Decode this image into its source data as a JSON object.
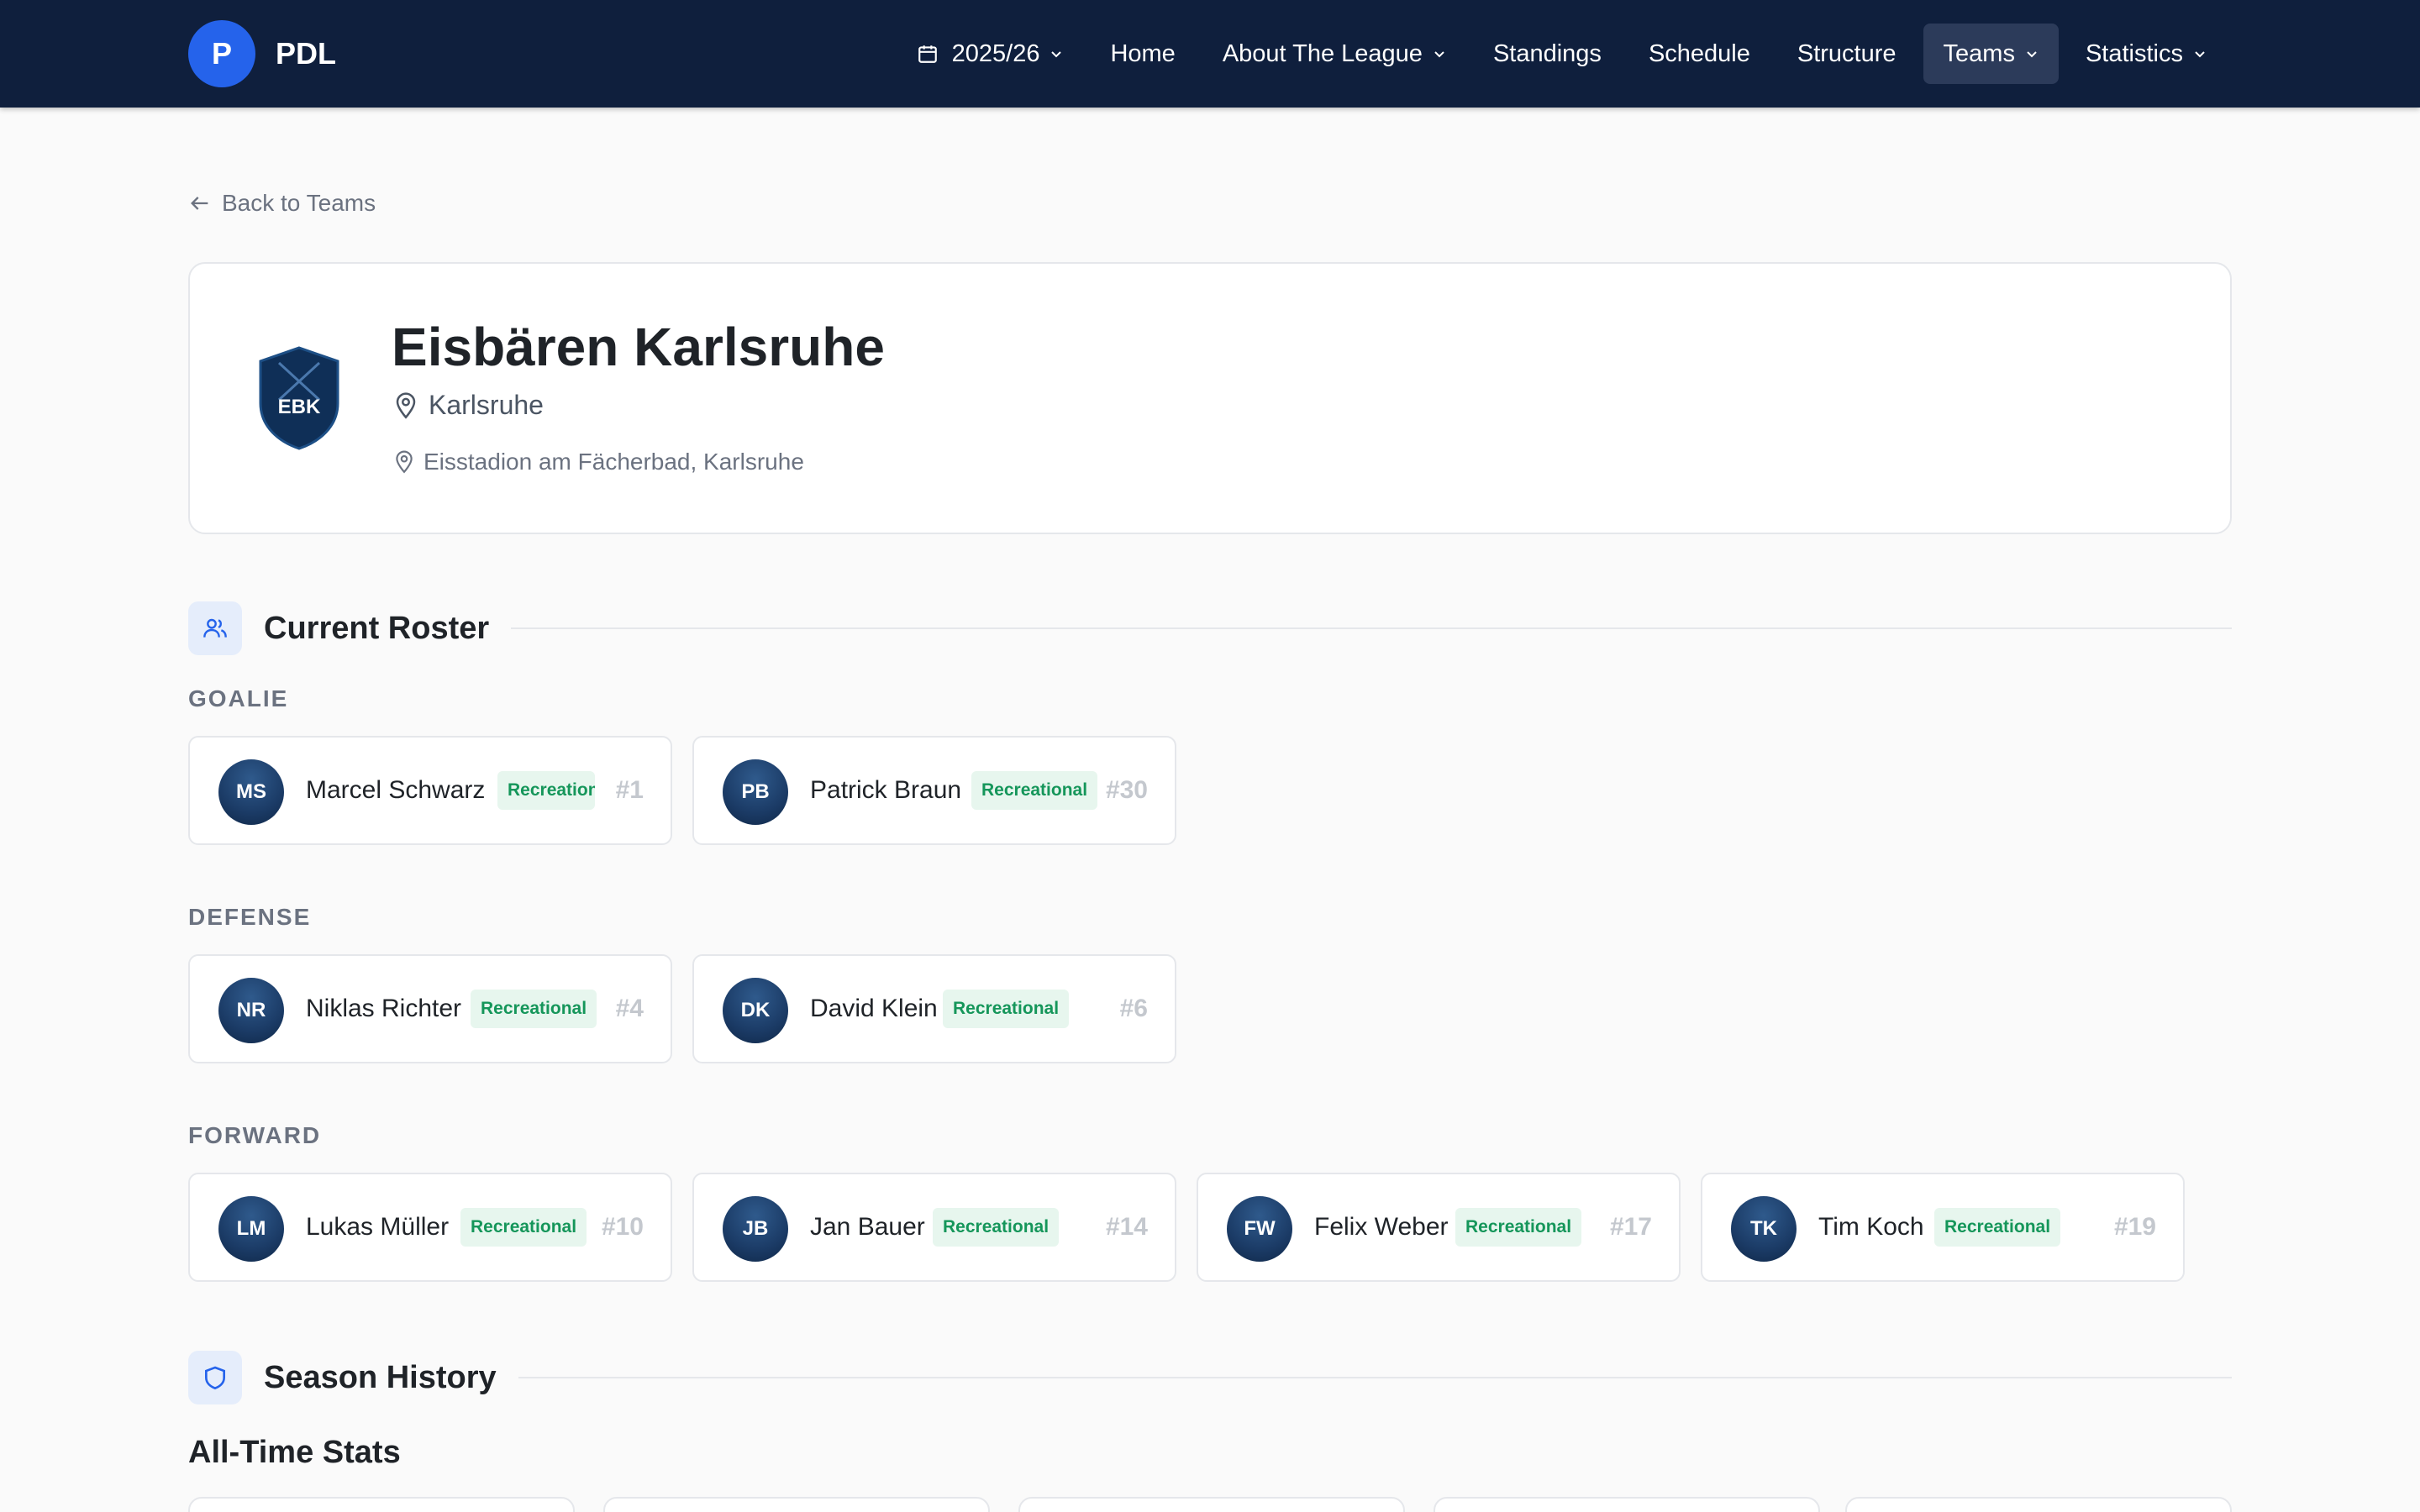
{
  "nav": {
    "brand_initial": "P",
    "brand_name": "PDL",
    "season": "2025/26",
    "items": [
      {
        "label": "Home"
      },
      {
        "label": "About The League"
      },
      {
        "label": "Standings"
      },
      {
        "label": "Schedule"
      },
      {
        "label": "Structure"
      },
      {
        "label": "Teams"
      },
      {
        "label": "Statistics"
      }
    ]
  },
  "back_link": "Back to Teams",
  "team": {
    "name": "Eisbären Karlsruhe",
    "city": "Karlsruhe",
    "arena": "Eisstadion am Fächerbad, Karlsruhe",
    "logo_text": "EBK",
    "logo_color": "#0f2f57"
  },
  "roster": {
    "title": "Current Roster",
    "groups": [
      {
        "label": "GOALIE",
        "players": [
          {
            "initials": "MS",
            "name": "Marcel Schwarz",
            "level": "Recreational",
            "number": "#1"
          },
          {
            "initials": "PB",
            "name": "Patrick Braun",
            "level": "Recreational",
            "number": "#30"
          }
        ]
      },
      {
        "label": "DEFENSE",
        "players": [
          {
            "initials": "NR",
            "name": "Niklas Richter",
            "level": "Recreational",
            "number": "#4"
          },
          {
            "initials": "DK",
            "name": "David Klein",
            "level": "Recreational",
            "number": "#6"
          }
        ]
      },
      {
        "label": "FORWARD",
        "players": [
          {
            "initials": "LM",
            "name": "Lukas Müller",
            "level": "Recreational",
            "number": "#10"
          },
          {
            "initials": "JB",
            "name": "Jan Bauer",
            "level": "Recreational",
            "number": "#14"
          },
          {
            "initials": "FW",
            "name": "Felix Weber",
            "level": "Recreational",
            "number": "#17"
          },
          {
            "initials": "TK",
            "name": "Tim Koch",
            "level": "Recreational",
            "number": "#19"
          }
        ]
      }
    ]
  },
  "season_history": {
    "title": "Season History",
    "subtitle": "All-Time Stats"
  },
  "colors": {
    "nav_bg": "#0f1f3d",
    "accent": "#2563eb",
    "badge_bg": "#e7f6ee",
    "badge_text": "#15965a"
  }
}
